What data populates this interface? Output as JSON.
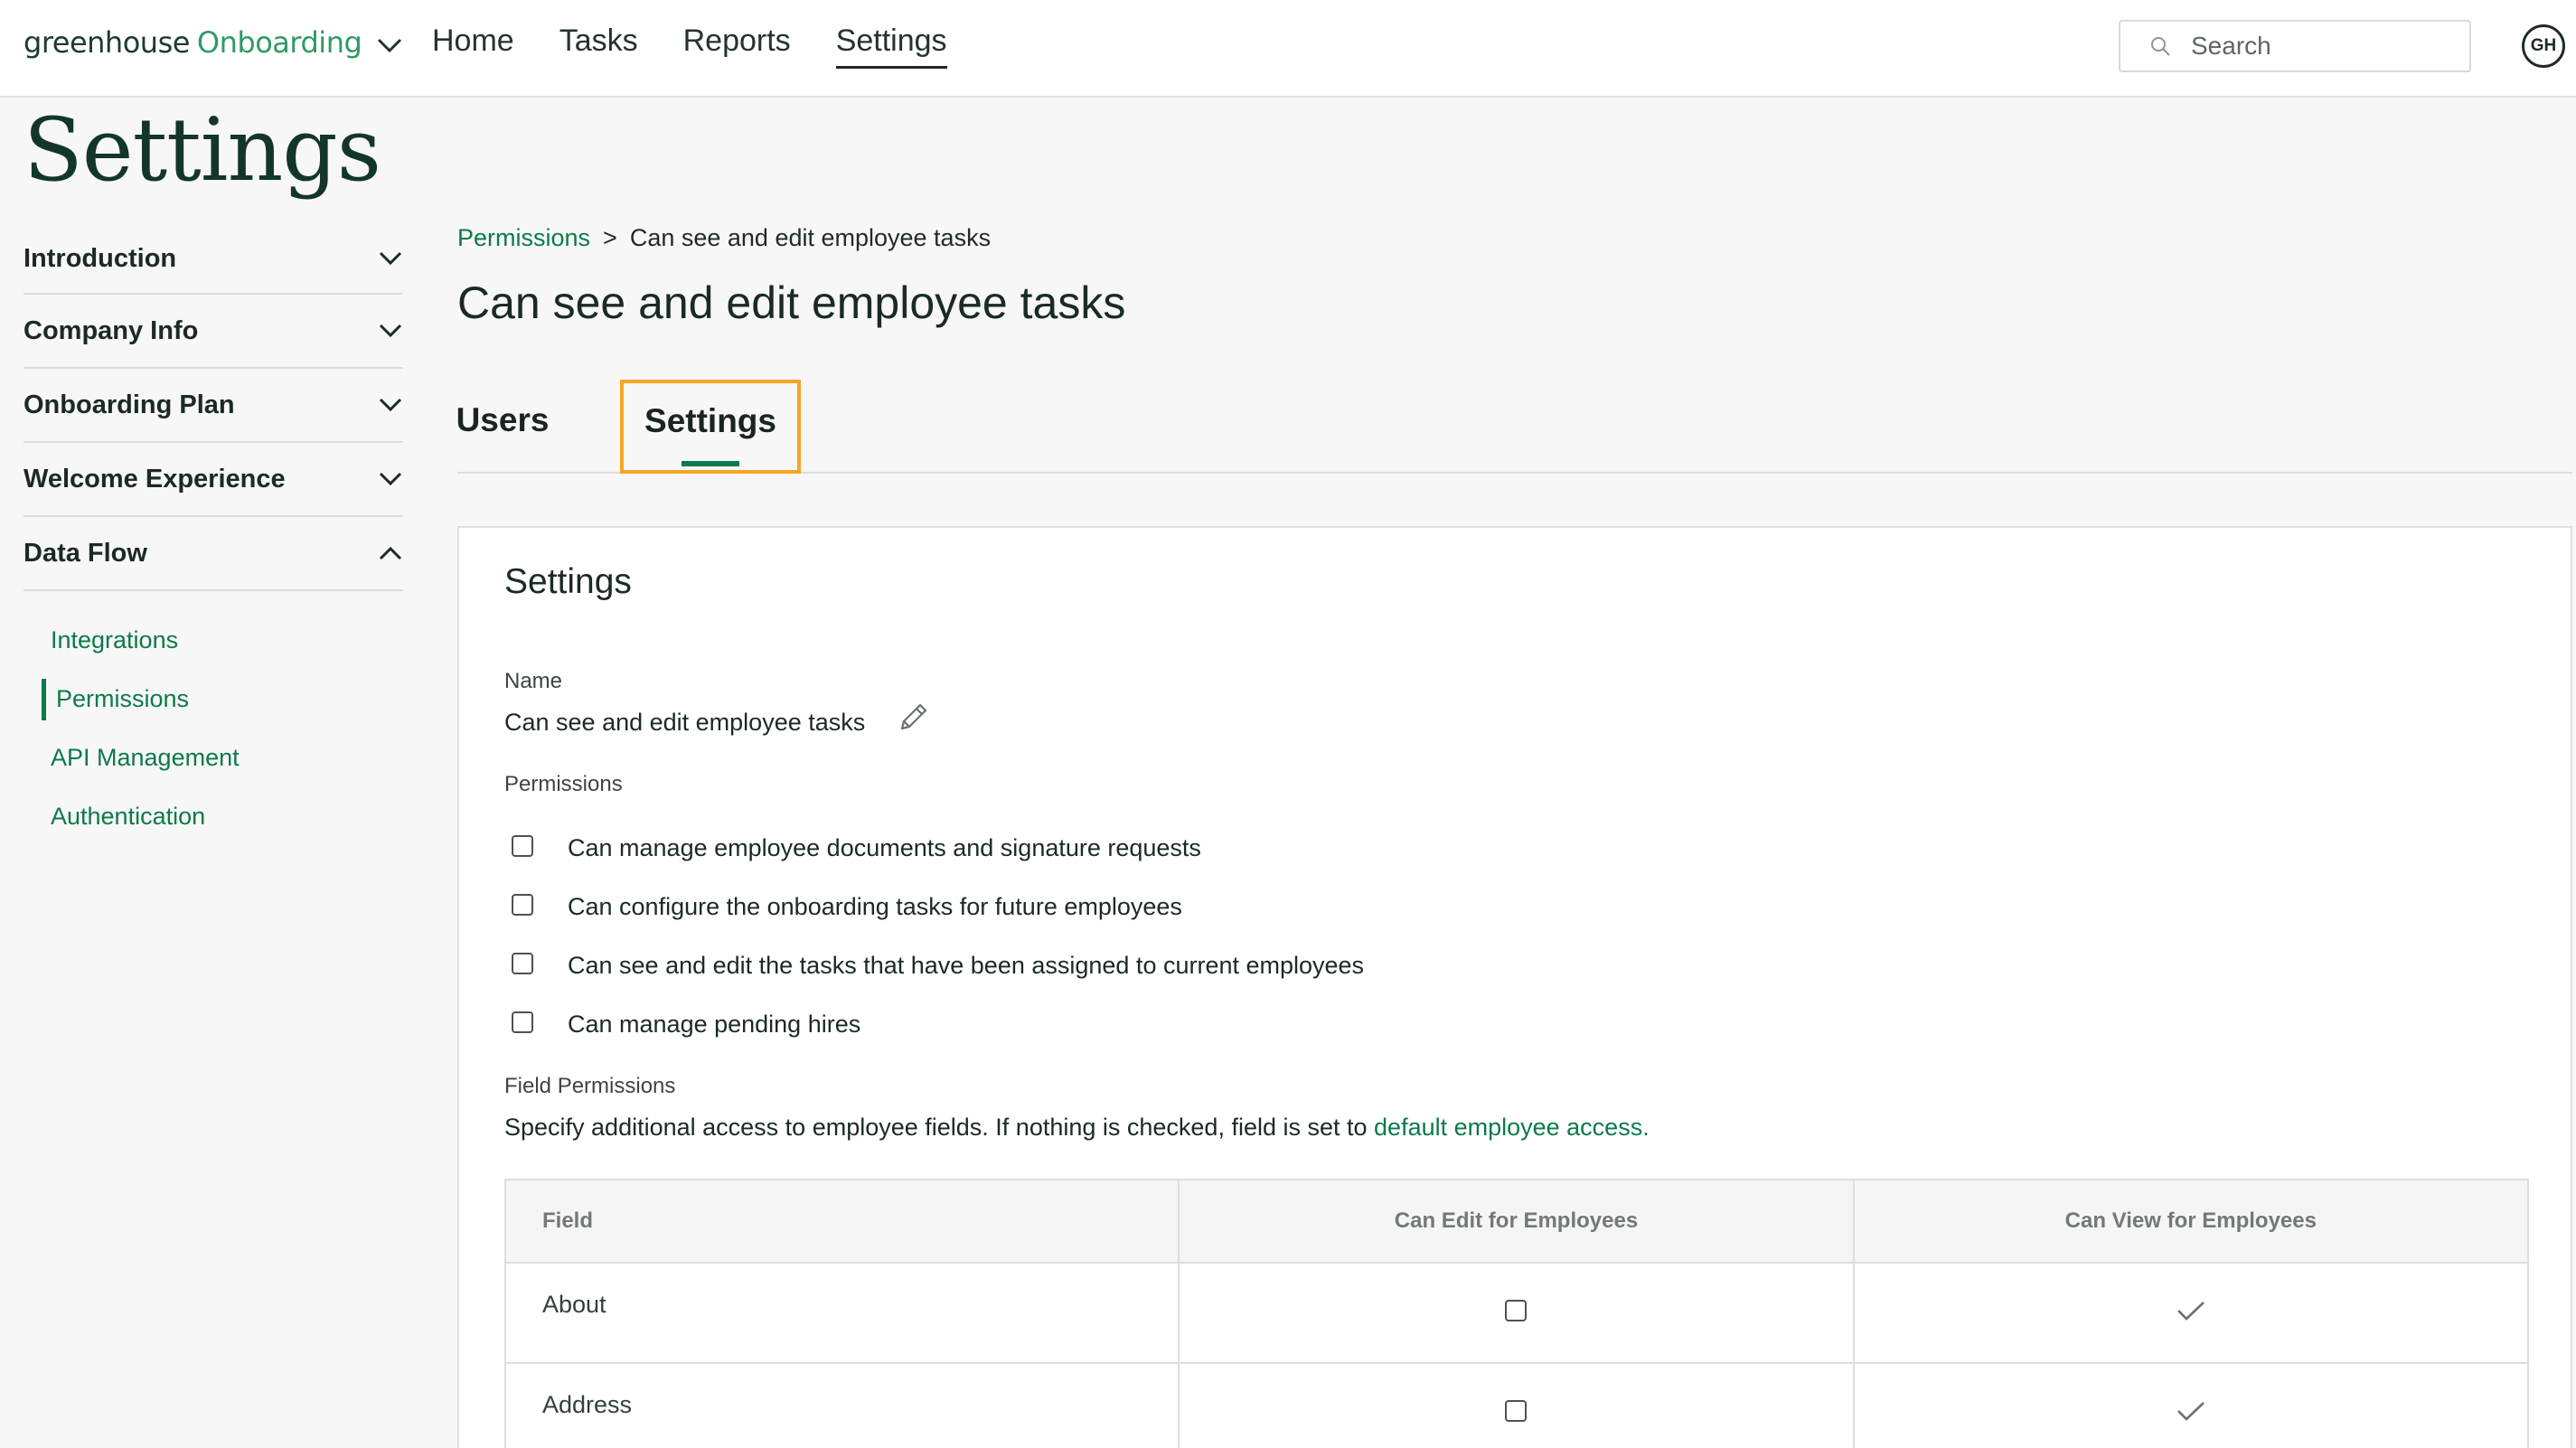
{
  "app": {
    "brand_main": "greenhouse",
    "brand_sub": "Onboarding",
    "brand_menu_icon": "chevron-down-icon"
  },
  "nav": {
    "items": [
      {
        "label": "Home"
      },
      {
        "label": "Tasks"
      },
      {
        "label": "Reports"
      },
      {
        "label": "Settings"
      }
    ],
    "active": "Settings"
  },
  "search": {
    "placeholder": "Search",
    "icon": "search-icon"
  },
  "user": {
    "initials": "GH"
  },
  "page": {
    "title": "Settings"
  },
  "sidebar": {
    "sections": [
      {
        "label": "Introduction",
        "icon": "chevron-down-icon"
      },
      {
        "label": "Company Info",
        "icon": "chevron-down-icon"
      },
      {
        "label": "Onboarding Plan",
        "icon": "chevron-down-icon"
      },
      {
        "label": "Welcome Experience",
        "icon": "chevron-down-icon"
      },
      {
        "label": "Data Flow",
        "icon": "chevron-up-icon"
      }
    ],
    "sub_items": [
      {
        "label": "Integrations"
      },
      {
        "label": "Permissions"
      },
      {
        "label": "API Management"
      },
      {
        "label": "Authentication"
      }
    ],
    "active_sub": "Permissions"
  },
  "breadcrumb": {
    "parent": "Permissions",
    "separator": ">",
    "current": "Can see and edit employee tasks"
  },
  "main": {
    "title": "Can see and edit employee tasks",
    "tabs": [
      {
        "label": "Users"
      },
      {
        "label": "Settings"
      }
    ],
    "active_tab": "Settings"
  },
  "card": {
    "title": "Settings",
    "name_label": "Name",
    "name_value": "Can see and edit employee tasks",
    "edit_icon": "pencil-icon",
    "permissions_label": "Permissions",
    "permissions": [
      {
        "label": "Can manage employee documents and signature requests",
        "checked": false
      },
      {
        "label": "Can configure the onboarding tasks for future employees",
        "checked": false
      },
      {
        "label": "Can see and edit the tasks that have been assigned to current employees",
        "checked": false
      },
      {
        "label": "Can manage pending hires",
        "checked": false
      }
    ],
    "field_permissions_label": "Field Permissions",
    "field_permissions_desc": "Specify additional access to employee fields. If nothing is checked, field is set to ",
    "field_permissions_link": "default employee access."
  },
  "table": {
    "headers": [
      "Field",
      "Can Edit for Employees",
      "Can View for Employees"
    ],
    "rows": [
      {
        "field": "About",
        "can_edit": false,
        "can_view": true
      },
      {
        "field": "Address",
        "can_edit": false,
        "can_view": true
      }
    ]
  },
  "colors": {
    "brand_green": "#2f9a65",
    "link_green": "#0c7a4a",
    "highlight_orange": "#f5a623",
    "title_green": "#13362a"
  }
}
